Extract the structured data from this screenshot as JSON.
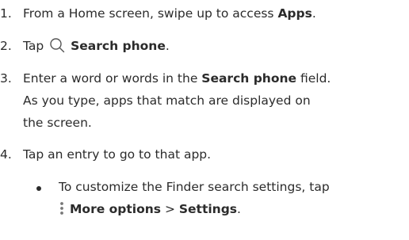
{
  "steps": [
    {
      "number": "1.",
      "prefix": "From a Home screen, swipe up to access ",
      "bold": "Apps",
      "suffix": "."
    },
    {
      "number": "2.",
      "prefix": "Tap ",
      "icon": "search-icon",
      "bold": "Search phone",
      "suffix": "."
    },
    {
      "number": "3.",
      "prefix": "Enter a word or words in the ",
      "bold": "Search phone",
      "suffix": " field.",
      "line2": "As you type, apps that match are displayed on",
      "line3": "the screen."
    },
    {
      "number": "4.",
      "text": "Tap an entry to go to that app."
    }
  ],
  "sub_bullet": {
    "line1": "To customize the Finder search settings, tap",
    "icon": "more-options-icon",
    "bold1": "More options",
    "separator": " > ",
    "bold2": "Settings",
    "suffix": "."
  }
}
